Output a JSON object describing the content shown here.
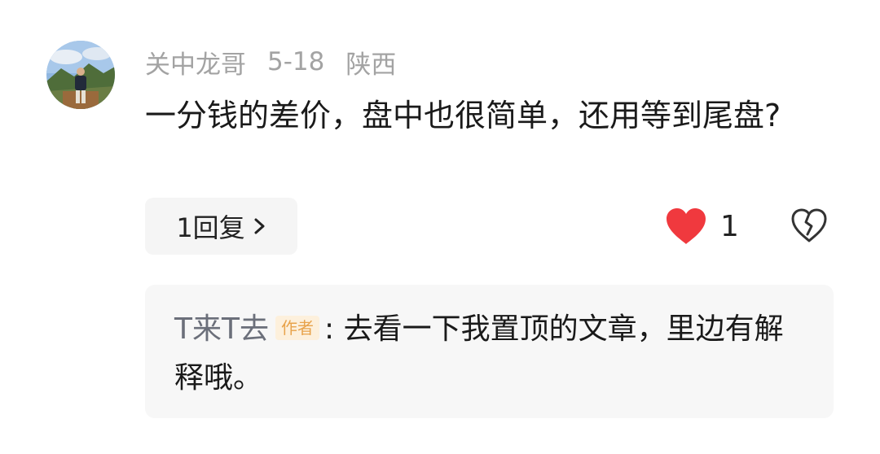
{
  "comment": {
    "avatar": "user-avatar-photo",
    "username": "关中龙哥",
    "date": "5-18",
    "location": "陕西",
    "text": "一分钱的差价，盘中也很简单，还用等到尾盘?",
    "reply_button_label": "1回复",
    "like_count": "1",
    "icons": {
      "like": "heart-filled-icon",
      "dislike": "broken-heart-icon",
      "expand": "chevron-right-icon"
    },
    "colors": {
      "like": "#f0393e",
      "username": "#a3a3a3",
      "badge_text": "#e8a34b",
      "badge_bg": "#fdf0dc"
    }
  },
  "reply": {
    "username": "T来T去",
    "badge": "作者",
    "separator": ":",
    "text": "去看一下我置顶的文章，里边有解释哦。"
  }
}
